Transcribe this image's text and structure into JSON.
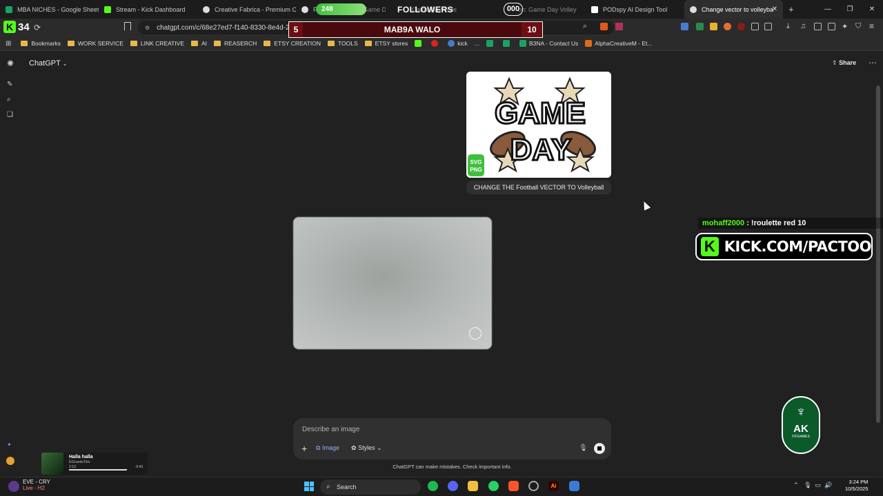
{
  "tabs": [
    {
      "label": "MBA NICHES - Google Sheets",
      "color": "#1aa260"
    },
    {
      "label": "Stream - Kick Dashboard",
      "color": "#53fc18"
    },
    {
      "label": "Creative Fabrica - Premium Cra",
      "color": "#dddddd"
    },
    {
      "label": "Fo",
      "color": "#dddddd"
    },
    {
      "label": "Game D",
      "color": "#888888"
    },
    {
      "label": "Game Day Volle",
      "color": "#888888"
    },
    {
      "label": "on: Game Day Volley",
      "color": "#888888"
    },
    {
      "label": "PODspy AI Design Tool",
      "color": "#ffffff"
    },
    {
      "label": "Change vector to volleyba",
      "color": "#dddddd"
    }
  ],
  "kick_viewers": "34",
  "url": "chatgpt.com/c/68e27ed7-f140-8330-8e4d-2c2",
  "bookmarks": [
    {
      "label": "Bookmarks",
      "type": "folder"
    },
    {
      "label": "WORK SERVICE",
      "type": "folder"
    },
    {
      "label": "LINK CREATIVE",
      "type": "folder"
    },
    {
      "label": "AI",
      "type": "folder"
    },
    {
      "label": "REASERCH",
      "type": "folder"
    },
    {
      "label": "ETSY CREATION",
      "type": "folder"
    },
    {
      "label": "TOOLS",
      "type": "folder"
    },
    {
      "label": "ETSY stores",
      "type": "folder"
    },
    {
      "label": "",
      "type": "kick"
    },
    {
      "label": "",
      "type": "youtube"
    },
    {
      "label": "kick",
      "type": "web"
    },
    {
      "label": "...",
      "type": "plain"
    },
    {
      "label": "",
      "type": "sheets"
    },
    {
      "label": "",
      "type": "sheets"
    },
    {
      "label": "B3NA - Contact Us",
      "type": "sheets"
    },
    {
      "label": "AlphaCreativeM - Et...",
      "type": "etsy"
    }
  ],
  "chat": {
    "model_label": "ChatGPT",
    "share_label": "Share",
    "user_image": {
      "title_top": "GAME",
      "title_bottom": "DAY",
      "badge_top": "SVG",
      "badge_bottom": "PNG"
    },
    "user_message": "CHANGE THE Football VECTOR TO Volleyball",
    "composer_placeholder": "Describe an image",
    "image_label": "Image",
    "styles_label": "Styles",
    "disclaimer": "ChatGPT can make mistakes. Check important info."
  },
  "overlay": {
    "followers_current": "248",
    "followers_label": "FOLLOWERS",
    "followers_goal": "000",
    "score_left": "5",
    "score_title": "MAB9A WALO",
    "score_right": "10",
    "chat_user": "mohaff2000",
    "chat_text": " : !roulette red 10",
    "kick_url": "KICK.COM/PACTOO",
    "ak_logo": "AK",
    "ak_sub": "FIFGAMES"
  },
  "music": {
    "title": "Halla halla",
    "artist": "ElGrandeToto",
    "elapsed": "2:13",
    "remaining": "-0:41"
  },
  "taskbar": {
    "stream_title": "EVE - CRY",
    "stream_status": "Live - H2",
    "search_label": "Search",
    "time": "3:24 PM",
    "date": "10/5/2025"
  },
  "colors": {
    "kick_green": "#53fc18",
    "background": "#212121",
    "score_red": "#6b0f12"
  }
}
